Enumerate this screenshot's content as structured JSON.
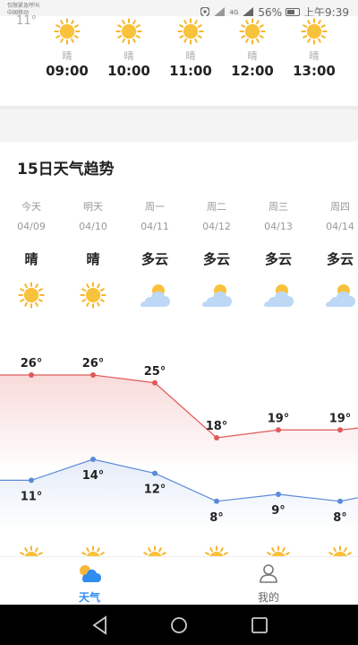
{
  "status_bar": {
    "carrier_line1": "仅限紧急呼叫",
    "carrier_line2": "中国移动",
    "partial_temp": "11°",
    "network": "4G",
    "battery": "56%",
    "time": "上午9:39"
  },
  "hourly": [
    {
      "cond": "晴",
      "time": "09:00",
      "icon": "sun-icon"
    },
    {
      "cond": "晴",
      "time": "10:00",
      "icon": "sun-icon"
    },
    {
      "cond": "晴",
      "time": "11:00",
      "icon": "sun-icon"
    },
    {
      "cond": "晴",
      "time": "12:00",
      "icon": "sun-icon"
    },
    {
      "cond": "晴",
      "time": "13:00",
      "icon": "sun-icon"
    }
  ],
  "forecast": {
    "title": "15日天气趋势",
    "days": [
      {
        "name": "今天",
        "date": "04/09",
        "cond": "晴",
        "icon": "sun-icon",
        "high": 26,
        "low": 11
      },
      {
        "name": "明天",
        "date": "04/10",
        "cond": "晴",
        "icon": "sun-icon",
        "high": 26,
        "low": 14
      },
      {
        "name": "周一",
        "date": "04/11",
        "cond": "多云",
        "icon": "cloud-sun-icon",
        "high": 25,
        "low": 12
      },
      {
        "name": "周二",
        "date": "04/12",
        "cond": "多云",
        "icon": "cloud-sun-icon",
        "high": 18,
        "low": 8
      },
      {
        "name": "周三",
        "date": "04/13",
        "cond": "多云",
        "icon": "cloud-sun-icon",
        "high": 19,
        "low": 9
      },
      {
        "name": "周四",
        "date": "04/14",
        "cond": "多云",
        "icon": "cloud-sun-icon",
        "high": 19,
        "low": 8
      }
    ],
    "high_color": "#e05a5a",
    "low_color": "#5b8ad8"
  },
  "nav": {
    "weather_label": "天气",
    "mine_label": "我的"
  }
}
